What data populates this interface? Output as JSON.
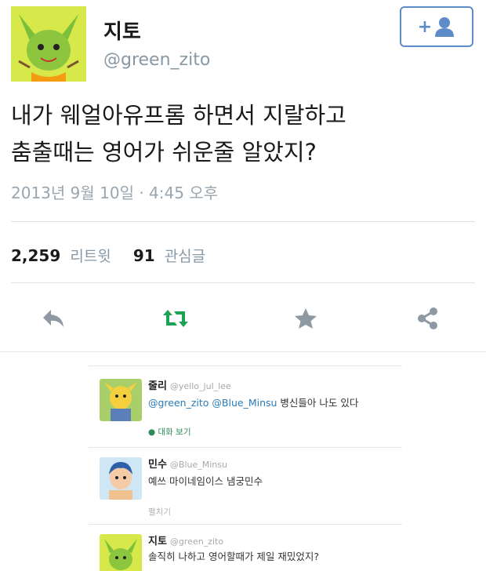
{
  "tweet": {
    "name": "지토",
    "handle": "@green_zito",
    "follow_label": "+",
    "text_line1": "내가 웨얼아유프롬 하면서 지랄하고",
    "text_line2": "춤출때는 영어가 쉬운줄 알았지?",
    "date": "2013년 9월 10일 · 4:45 오후",
    "retweets": "2,259",
    "retweets_label": "리트윗",
    "favorites": "91",
    "favorites_label": "관심글"
  },
  "colors": {
    "accent": "#5d8cc9",
    "retweet": "#1da154",
    "action_gray": "#8e99a4",
    "avatar_green": "#d7e84a"
  },
  "icons": [
    "reply-icon",
    "retweet-icon",
    "star-icon",
    "share-icon",
    "follow-person-icon"
  ],
  "replies": [
    {
      "name": "줄리",
      "handle": "@yello_jul_lee",
      "mentions": "@green_zito @Blue_Minsu",
      "text": " 병신들아 나도 있다",
      "link": "대화 보기"
    },
    {
      "name": "민수",
      "handle": "@Blue_Minsu",
      "text": "예쓰 마이네임이스 냄궁민수",
      "link": "펼치기"
    },
    {
      "name": "지토",
      "handle": "@green_zito",
      "text": "솔직히 나하고 영어할때가 제일 재밌었지?"
    }
  ]
}
